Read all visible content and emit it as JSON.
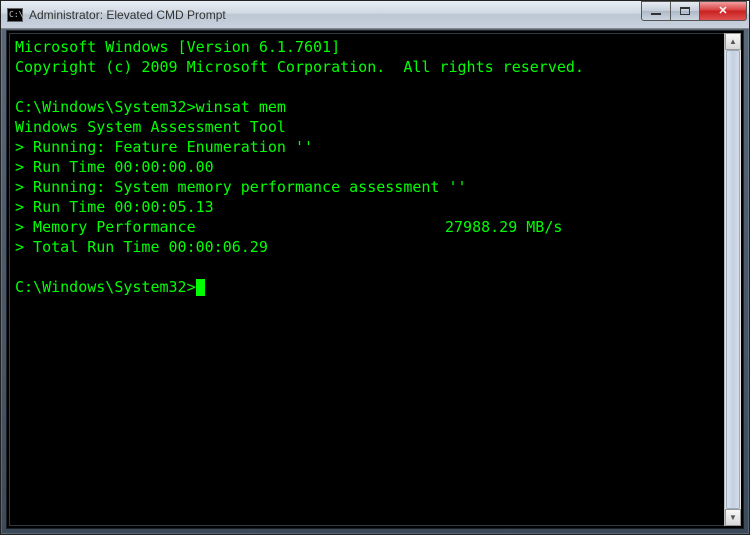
{
  "window": {
    "title": "Administrator: Elevated CMD Prompt",
    "icon_label": "C:\\"
  },
  "terminal": {
    "header1": "Microsoft Windows [Version 6.1.7601]",
    "header2": "Copyright (c) 2009 Microsoft Corporation.  All rights reserved.",
    "prompt1_path": "C:\\Windows\\System32>",
    "prompt1_cmd": "winsat mem",
    "tool_name": "Windows System Assessment Tool",
    "line1": "> Running: Feature Enumeration ''",
    "line2": "> Run Time 00:00:00.00",
    "line3": "> Running: System memory performance assessment ''",
    "line4": "> Run Time 00:00:05.13",
    "mem_label": "> Memory Performance",
    "mem_value": "27988.29 MB/s",
    "line6": "> Total Run Time 00:00:06.29",
    "prompt2_path": "C:\\Windows\\System32>"
  },
  "controls": {
    "minimize": "minimize",
    "maximize": "maximize",
    "close": "close"
  }
}
